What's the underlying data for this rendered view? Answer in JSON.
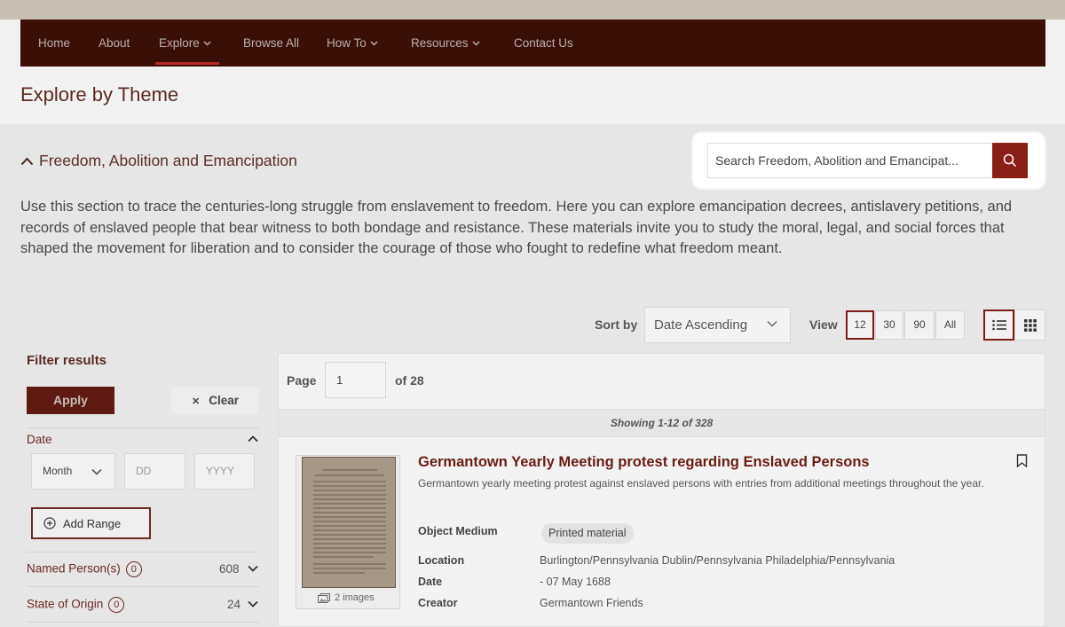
{
  "nav": {
    "items": [
      {
        "label": "Home"
      },
      {
        "label": "About"
      },
      {
        "label": "Explore"
      },
      {
        "label": "Browse All"
      },
      {
        "label": "How To"
      },
      {
        "label": "Resources"
      },
      {
        "label": "Contact Us"
      }
    ]
  },
  "page": {
    "title": "Explore by Theme"
  },
  "theme": {
    "title": "Freedom, Abolition and Emancipation",
    "description": "Use this section to trace the centuries-long struggle from enslavement to freedom. Here you can explore emancipation decrees, antislavery petitions, and records of enslaved people that bear witness to both bondage and resistance. These materials invite you to study the moral, legal, and social forces that shaped the movement for liberation and to consider the courage of those who fought to redefine what freedom meant."
  },
  "search": {
    "placeholder": "Search Freedom, Abolition and Emancipat..."
  },
  "toolbar": {
    "sort_label": "Sort by",
    "sort_value": "Date Ascending",
    "view_label": "View",
    "view_options": [
      "12",
      "30",
      "90",
      "All"
    ],
    "view_selected": "12"
  },
  "filters": {
    "title": "Filter results",
    "apply": "Apply",
    "clear": "Clear",
    "date": {
      "label": "Date",
      "month": "Month",
      "day_placeholder": "DD",
      "year_placeholder": "YYYY",
      "add_range": "Add Range"
    },
    "facets": [
      {
        "label": "Named Person(s)",
        "badge": "0",
        "count": "608"
      },
      {
        "label": "State of Origin",
        "badge": "0",
        "count": "24"
      }
    ]
  },
  "pagination": {
    "page_label": "Page",
    "page_value": "1",
    "of_label": "of 28",
    "showing": "Showing 1-12 of 328"
  },
  "result": {
    "title": "Germantown Yearly Meeting protest regarding Enslaved Persons",
    "description": "Germantown yearly meeting protest against enslaved persons with entries from additional meetings throughout the year.",
    "images_caption": "2 images",
    "fields": {
      "medium_label": "Object Medium",
      "medium_value": "Printed material",
      "location_label": "Location",
      "location_value": "Burlington/Pennsylvania Dublin/Pennsylvania Philadelphia/Pennsylvania",
      "date_label": "Date",
      "date_value": "- 07 May 1688",
      "creator_label": "Creator",
      "creator_value": "Germantown Friends"
    }
  },
  "colors": {
    "nav_bg": "#3c0e08",
    "accent": "#8a1f16",
    "title_text": "#6a1d15"
  }
}
